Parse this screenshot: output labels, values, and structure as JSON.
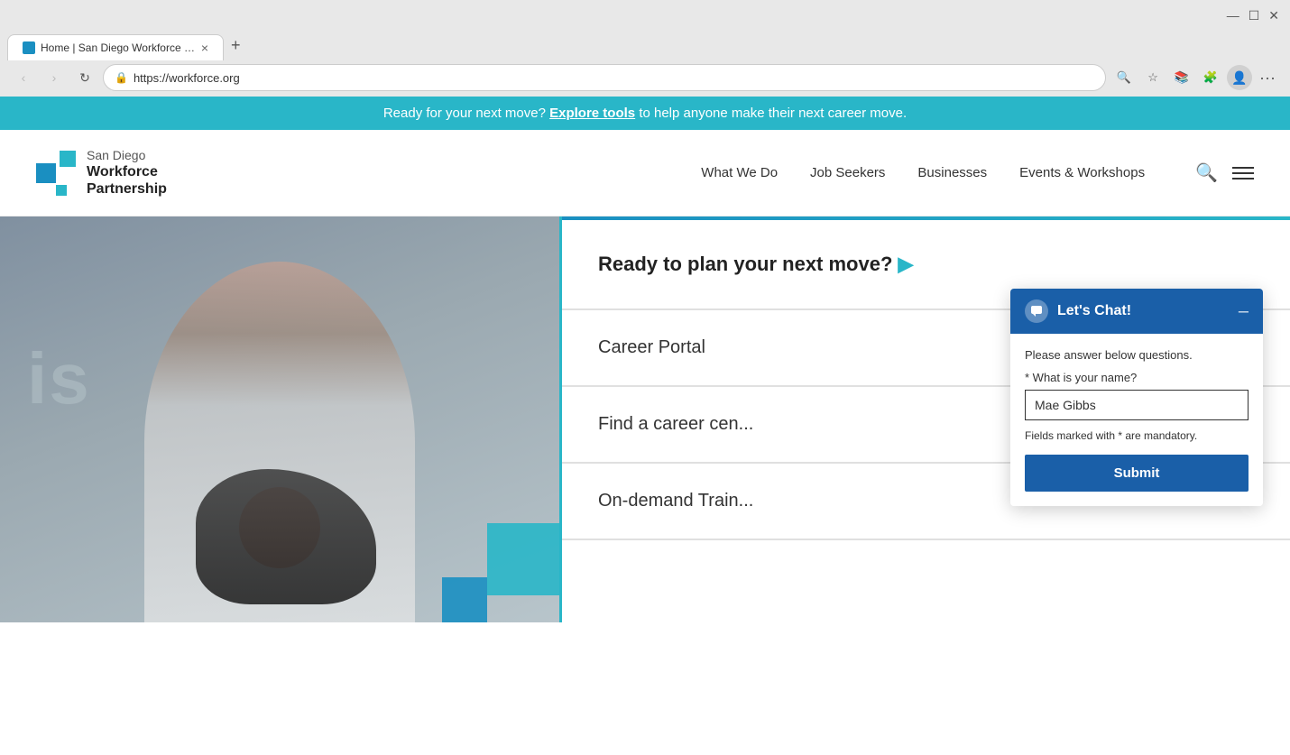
{
  "browser": {
    "tab_title": "Home | San Diego Workforce Pa...",
    "tab_close": "×",
    "new_tab": "+",
    "nav_back": "‹",
    "nav_forward": "›",
    "nav_refresh": "↻",
    "url": "https://workforce.org",
    "zoom_icon": "🔍",
    "star_icon": "☆",
    "extensions_icon": "🧩",
    "shield_icon": "🛡",
    "profile_icon": "👤",
    "more_icon": "⋯"
  },
  "announcement": {
    "text_before": "Ready for your next move?",
    "link_text": "Explore tools",
    "text_after": "to help anyone make their next career move."
  },
  "nav": {
    "logo_line1": "San Diego",
    "logo_line2": "Workforce",
    "logo_line3": "Partnership",
    "link_what_we_do": "What We Do",
    "link_job_seekers": "Job Seekers",
    "link_businesses": "Businesses",
    "link_events": "Events & Workshops"
  },
  "hero": {
    "text_overlay": "is",
    "right_panel": [
      {
        "label": "Ready to plan your next move? ▶",
        "id": "plan-move"
      },
      {
        "label": "Career Portal",
        "id": "career-portal"
      },
      {
        "label": "Find a career cen...",
        "id": "find-career-center"
      },
      {
        "label": "On-demand Train...",
        "id": "on-demand-training"
      }
    ]
  },
  "chat": {
    "header_title": "Let's Chat!",
    "minimize": "–",
    "instructions": "Please answer below questions.",
    "field_label": "* What is your name?",
    "input_value": "Mae Gibbs",
    "mandatory_note": "Fields marked with * are mandatory.",
    "submit_label": "Submit"
  }
}
